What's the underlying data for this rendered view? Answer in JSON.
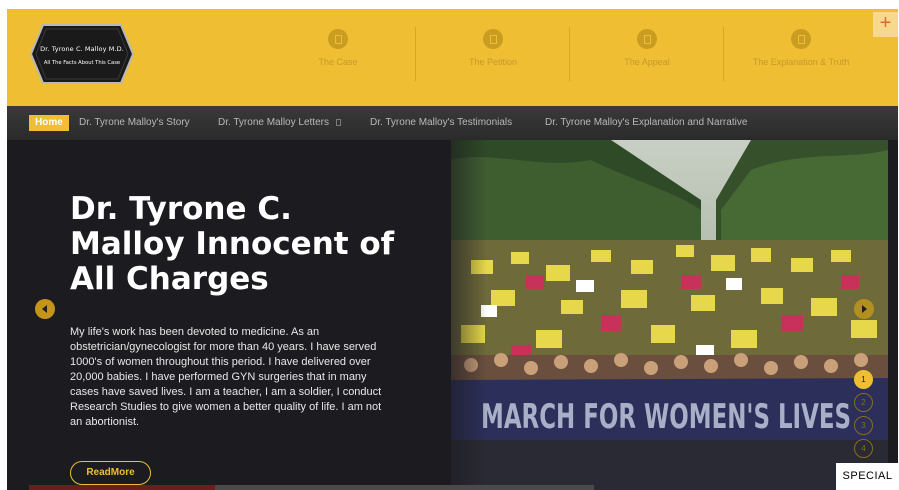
{
  "header": {
    "logo": {
      "line1": "Dr. Tyrone C. Malloy M.D.",
      "line2": "All The Facts About This Case"
    },
    "nav": [
      {
        "label": "The Case",
        "icon": "document-icon"
      },
      {
        "label": "The Petition",
        "icon": "document-icon"
      },
      {
        "label": "The Appeal",
        "icon": "document-icon"
      },
      {
        "label": "The Explanation & Truth",
        "icon": "document-icon"
      }
    ],
    "plus_label": "+"
  },
  "mainnav": {
    "home": "Home",
    "links": [
      "Dr. Tyrone Malloy's Story",
      "Dr. Tyrone Malloy Letters",
      "Dr. Tyrone Malloy's Testimonials",
      "Dr. Tyrone Malloy's Explanation and Narrative"
    ]
  },
  "hero": {
    "title": "Dr. Tyrone C. Malloy Innocent of All Charges",
    "text": "My life's work has been devoted to medicine. As an obstetrician/gynecologist for more than 40 years. I have served 1000's of women throughout this period. I have delivered  over 20,000 babies.  I have performed GYN surgeries that in many cases have saved lives. I am a teacher, I am a soldier, I conduct Research Studies to give women a better quality of life. I am not an abortionist.",
    "button": "ReadMore",
    "banner": "MARCH FOR WOMEN'S LIVES",
    "pager": [
      "1",
      "2",
      "3",
      "4"
    ],
    "active_slide": 1,
    "progress_fraction": 0.33
  },
  "badge": "SPECIAL",
  "colors": {
    "accent": "#efbe32",
    "dark": "#1f1e22"
  }
}
